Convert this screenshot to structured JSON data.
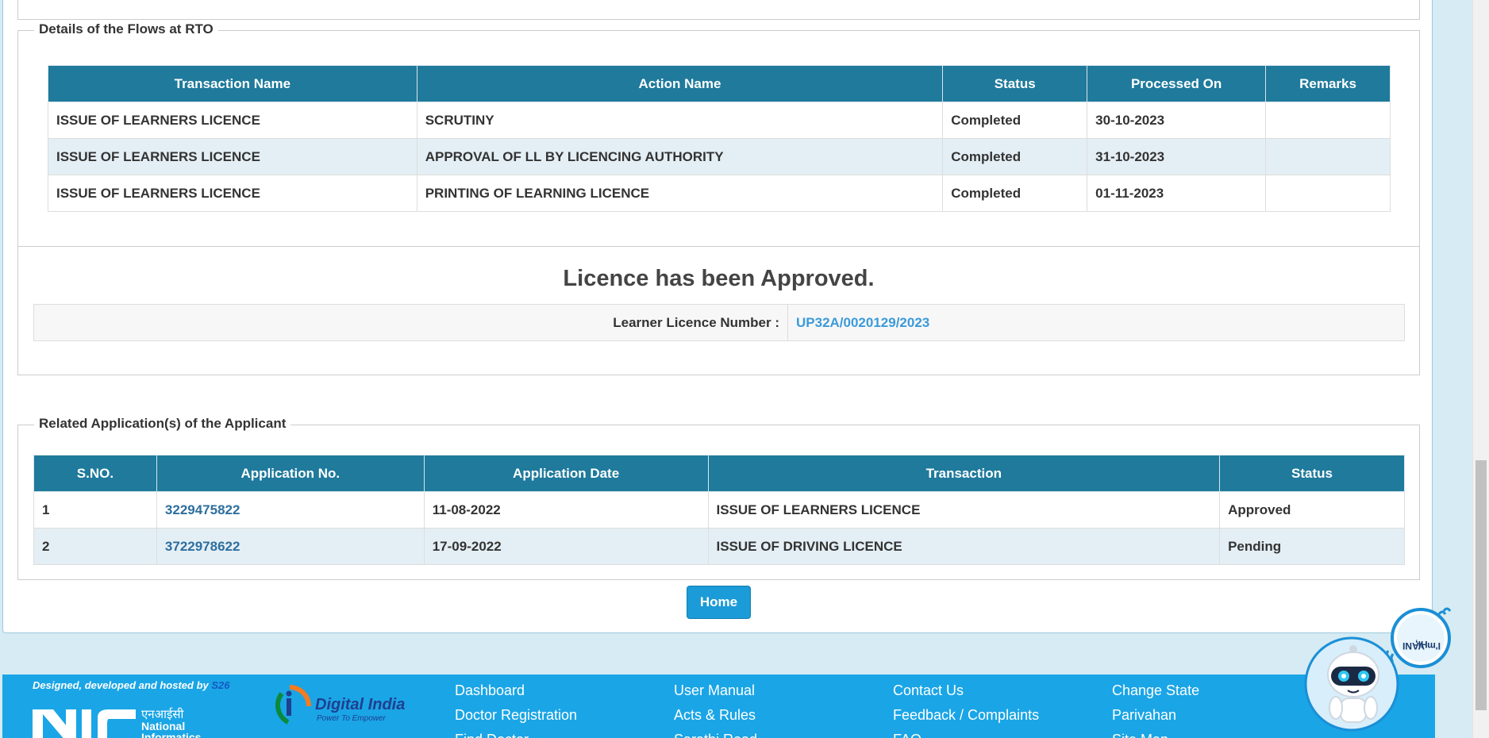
{
  "flows": {
    "legend": "Details of the Flows at RTO",
    "headers": [
      "Transaction Name",
      "Action Name",
      "Status",
      "Processed On",
      "Remarks"
    ],
    "rows": [
      [
        "ISSUE OF LEARNERS LICENCE",
        "SCRUTINY",
        "Completed",
        "30-10-2023",
        ""
      ],
      [
        "ISSUE OF LEARNERS LICENCE",
        "APPROVAL OF LL BY LICENCING AUTHORITY",
        "Completed",
        "31-10-2023",
        ""
      ],
      [
        "ISSUE OF LEARNERS LICENCE",
        "PRINTING OF LEARNING LICENCE",
        "Completed",
        "01-11-2023",
        ""
      ]
    ]
  },
  "approval": {
    "title": "Licence has been Approved.",
    "ll_label": "Learner Licence Number :",
    "ll_number": "UP32A/0020129/2023"
  },
  "related": {
    "legend": "Related Application(s) of the Applicant",
    "headers": [
      "S.NO.",
      "Application No.",
      "Application Date",
      "Transaction",
      "Status"
    ],
    "rows": [
      [
        "1",
        "3229475822",
        "11-08-2022",
        "ISSUE OF LEARNERS LICENCE",
        "Approved"
      ],
      [
        "2",
        "3722978622",
        "17-09-2022",
        "ISSUE OF DRIVING LICENCE",
        "Pending"
      ]
    ]
  },
  "home_button": "Home",
  "footer": {
    "credit_prefix": "Designed, developed and hosted by",
    "credit_link": "S26",
    "nic_hindi": "एनआईसी",
    "nic_english_1": "National",
    "nic_english_2": "Informatics",
    "di_title": "Digital India",
    "di_tagline": "Power To Empower",
    "col1": [
      "Dashboard",
      "Doctor Registration",
      "Find Doctor"
    ],
    "col2": [
      "User Manual",
      "Acts & Rules",
      "Sarathi Road"
    ],
    "col3": [
      "Contact Us",
      "Feedback / Complaints",
      "FAQ"
    ],
    "col4": [
      "Change State",
      "Parivahan",
      "Site Map"
    ]
  },
  "chatbot": {
    "bubble_text_1": "I'm VANI",
    "bubble_text_2": "Hi,",
    "icon": "robot-chatbot-icon"
  },
  "colors": {
    "header_bg": "#1f7a9c",
    "footer_bg": "#1aa5e6",
    "link": "#2d6e9e",
    "ll_number": "#3a9ad9",
    "button": "#1b9bd7"
  }
}
